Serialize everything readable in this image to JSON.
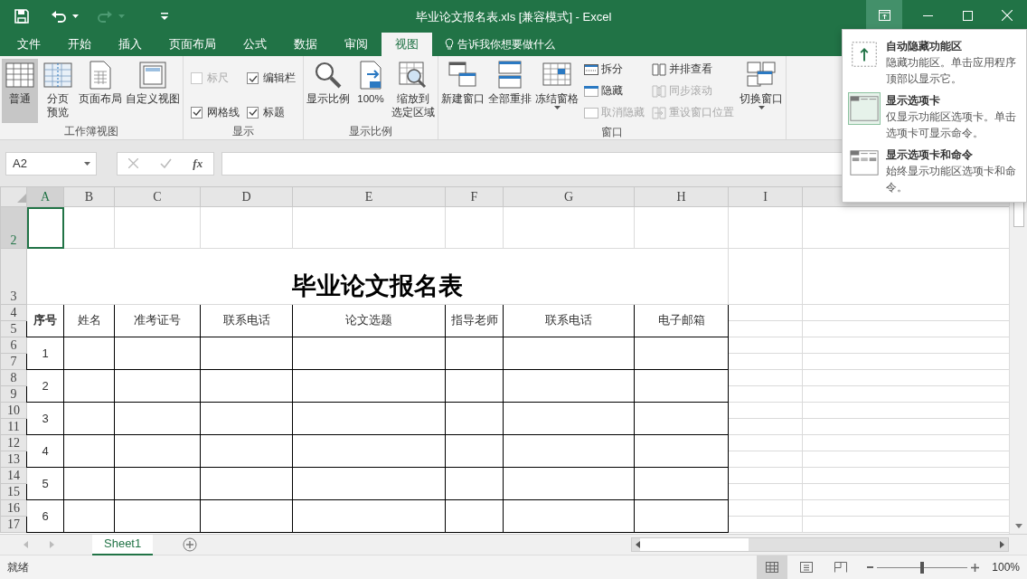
{
  "title_bar": {
    "title": "毕业论文报名表.xls  [兼容模式] - Excel",
    "redo_disabled": true
  },
  "tabs": [
    {
      "label": "文件",
      "selected": false
    },
    {
      "label": "开始",
      "selected": false
    },
    {
      "label": "插入",
      "selected": false
    },
    {
      "label": "页面布局",
      "selected": false
    },
    {
      "label": "公式",
      "selected": false
    },
    {
      "label": "数据",
      "selected": false
    },
    {
      "label": "审阅",
      "selected": false
    },
    {
      "label": "视图",
      "selected": true
    }
  ],
  "tell_me": "告诉我你想要做什么",
  "ribbon_groups": [
    {
      "label": "工作簿视图",
      "items": [
        {
          "kind": "large",
          "lines": [
            "普通"
          ],
          "selected": true
        },
        {
          "kind": "large",
          "lines": [
            "分页",
            "预览"
          ],
          "selected": false
        },
        {
          "kind": "large",
          "lines": [
            "页面布局"
          ],
          "selected": false
        },
        {
          "kind": "large",
          "lines": [
            "自定义视图"
          ],
          "selected": false
        }
      ]
    },
    {
      "label": "显示",
      "items": [
        {
          "kind": "checkbox",
          "label": "标尺",
          "checked": false,
          "disabled": true
        },
        {
          "kind": "checkbox",
          "label": "编辑栏",
          "checked": true,
          "disabled": false
        },
        {
          "kind": "checkbox",
          "label": "网格线",
          "checked": true,
          "disabled": false
        },
        {
          "kind": "checkbox",
          "label": "标题",
          "checked": true,
          "disabled": false
        }
      ]
    },
    {
      "label": "显示比例",
      "items": [
        {
          "kind": "large",
          "lines": [
            "显示比例"
          ],
          "selected": false
        },
        {
          "kind": "large",
          "lines": [
            "100%"
          ],
          "selected": false
        },
        {
          "kind": "large",
          "lines": [
            "缩放到",
            "选定区域"
          ],
          "selected": false
        }
      ]
    },
    {
      "label": "窗口",
      "items": [
        {
          "kind": "large",
          "lines": [
            "新建窗口"
          ],
          "selected": false
        },
        {
          "kind": "large",
          "lines": [
            "全部重排"
          ],
          "selected": false
        },
        {
          "kind": "large",
          "lines": [
            "冻结窗格"
          ],
          "selected": false,
          "dropdown": true
        },
        {
          "kind": "stack",
          "buttons": [
            {
              "label": "拆分",
              "disabled": false
            },
            {
              "label": "隐藏",
              "disabled": false
            },
            {
              "label": "取消隐藏",
              "disabled": true
            }
          ]
        },
        {
          "kind": "stack",
          "buttons": [
            {
              "label": "并排查看",
              "disabled": false
            },
            {
              "label": "同步滚动",
              "disabled": true
            },
            {
              "label": "重设窗口位置",
              "disabled": true
            }
          ]
        },
        {
          "kind": "large",
          "lines": [
            "切换窗口"
          ],
          "selected": false,
          "dropdown": true
        }
      ]
    }
  ],
  "formula_bar": {
    "name_box": "A2",
    "function_label": "fx"
  },
  "sheet": {
    "columns": [
      {
        "label": "A",
        "selected": true
      },
      {
        "label": "B",
        "selected": false
      },
      {
        "label": "C",
        "selected": false
      },
      {
        "label": "D",
        "selected": false
      },
      {
        "label": "E",
        "selected": false
      },
      {
        "label": "F",
        "selected": false
      },
      {
        "label": "G",
        "selected": false
      },
      {
        "label": "H",
        "selected": false
      },
      {
        "label": "I",
        "selected": false
      }
    ],
    "rows": [
      {
        "label": "2",
        "selected": true
      },
      {
        "label": "3",
        "selected": false
      },
      {
        "label": "4",
        "selected": false
      },
      {
        "label": "5",
        "selected": false
      },
      {
        "label": "6",
        "selected": false
      },
      {
        "label": "7",
        "selected": false
      },
      {
        "label": "8",
        "selected": false
      },
      {
        "label": "9",
        "selected": false
      },
      {
        "label": "10",
        "selected": false
      },
      {
        "label": "11",
        "selected": false
      },
      {
        "label": "12",
        "selected": false
      },
      {
        "label": "13",
        "selected": false
      },
      {
        "label": "14",
        "selected": false
      },
      {
        "label": "15",
        "selected": false
      },
      {
        "label": "16",
        "selected": false
      },
      {
        "label": "17",
        "selected": false
      }
    ],
    "title": "毕业论文报名表",
    "headers": [
      "序号",
      "姓名",
      "准考证号",
      "联系电话",
      "论文选题",
      "指导老师",
      "联系电话",
      "电子邮箱"
    ],
    "records": [
      "1",
      "2",
      "3",
      "4",
      "5",
      "6"
    ]
  },
  "sheet_tabs": [
    {
      "label": "Sheet1",
      "selected": true
    }
  ],
  "status_bar": {
    "status": "就绪",
    "views": [
      {
        "selected": true
      },
      {
        "selected": false
      },
      {
        "selected": false
      }
    ],
    "level": 0.5,
    "zoom": "100%"
  },
  "ribbon_display_menu": [
    {
      "title": "自动隐藏功能区",
      "description": "隐藏功能区。单击应用程序顶部以显示它。",
      "selected": false
    },
    {
      "title": "显示选项卡",
      "description": "仅显示功能区选项卡。单击选项卡可显示命令。",
      "selected": true
    },
    {
      "title": "显示选项卡和命令",
      "description": "始终显示功能区选项卡和命令。",
      "selected": false
    }
  ]
}
